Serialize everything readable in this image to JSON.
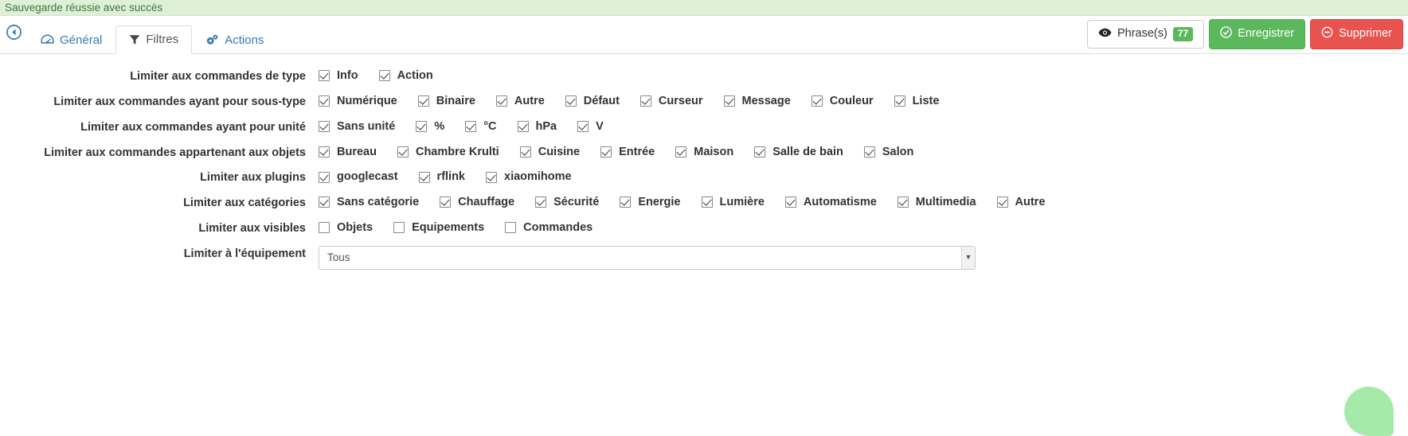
{
  "alert": {
    "message": "Sauvegarde réussie avec succès"
  },
  "toolbar": {
    "back_icon": "back-arrow-icon",
    "tabs": [
      {
        "label": "Général",
        "icon": "dashboard-icon",
        "active": false
      },
      {
        "label": "Filtres",
        "icon": "filter-icon",
        "active": true
      },
      {
        "label": "Actions",
        "icon": "gears-icon",
        "active": false
      }
    ],
    "phrases_label": "Phrase(s)",
    "phrases_count": "77",
    "save_label": "Enregistrer",
    "delete_label": "Supprimer"
  },
  "colors": {
    "alert_bg": "#dff0d8",
    "alert_text": "#3c763d",
    "link": "#337ab7",
    "success": "#5cb85c",
    "danger": "#e9534f",
    "fab": "#a5eaa9"
  },
  "form": {
    "rows": [
      {
        "label": "Limiter aux commandes de type",
        "options": [
          {
            "label": "Info",
            "checked": true
          },
          {
            "label": "Action",
            "checked": true
          }
        ]
      },
      {
        "label": "Limiter aux commandes ayant pour sous-type",
        "options": [
          {
            "label": "Numérique",
            "checked": true
          },
          {
            "label": "Binaire",
            "checked": true
          },
          {
            "label": "Autre",
            "checked": true
          },
          {
            "label": "Défaut",
            "checked": true
          },
          {
            "label": "Curseur",
            "checked": true
          },
          {
            "label": "Message",
            "checked": true
          },
          {
            "label": "Couleur",
            "checked": true
          },
          {
            "label": "Liste",
            "checked": true
          }
        ]
      },
      {
        "label": "Limiter aux commandes ayant pour unité",
        "options": [
          {
            "label": "Sans unité",
            "checked": true
          },
          {
            "label": "%",
            "checked": true
          },
          {
            "label": "°C",
            "checked": true
          },
          {
            "label": "hPa",
            "checked": true
          },
          {
            "label": "V",
            "checked": true
          }
        ]
      },
      {
        "label": "Limiter aux commandes appartenant aux objets",
        "options": [
          {
            "label": "Bureau",
            "checked": true
          },
          {
            "label": "Chambre Krulti",
            "checked": true
          },
          {
            "label": "Cuisine",
            "checked": true
          },
          {
            "label": "Entrée",
            "checked": true
          },
          {
            "label": "Maison",
            "checked": true
          },
          {
            "label": "Salle de bain",
            "checked": true
          },
          {
            "label": "Salon",
            "checked": true
          }
        ]
      },
      {
        "label": "Limiter aux plugins",
        "options": [
          {
            "label": "googlecast",
            "checked": true
          },
          {
            "label": "rflink",
            "checked": true
          },
          {
            "label": "xiaomihome",
            "checked": true
          }
        ]
      },
      {
        "label": "Limiter aux catégories",
        "options": [
          {
            "label": "Sans catégorie",
            "checked": true
          },
          {
            "label": "Chauffage",
            "checked": true
          },
          {
            "label": "Sécurité",
            "checked": true
          },
          {
            "label": "Energie",
            "checked": true
          },
          {
            "label": "Lumière",
            "checked": true
          },
          {
            "label": "Automatisme",
            "checked": true
          },
          {
            "label": "Multimedia",
            "checked": true
          },
          {
            "label": "Autre",
            "checked": true
          }
        ]
      },
      {
        "label": "Limiter aux visibles",
        "options": [
          {
            "label": "Objets",
            "checked": false
          },
          {
            "label": "Equipements",
            "checked": false
          },
          {
            "label": "Commandes",
            "checked": false
          }
        ]
      }
    ],
    "equipment": {
      "label": "Limiter à l'équipement",
      "selected": "Tous",
      "options": [
        "Tous"
      ]
    }
  },
  "fab": {
    "name": "help-bubble"
  }
}
